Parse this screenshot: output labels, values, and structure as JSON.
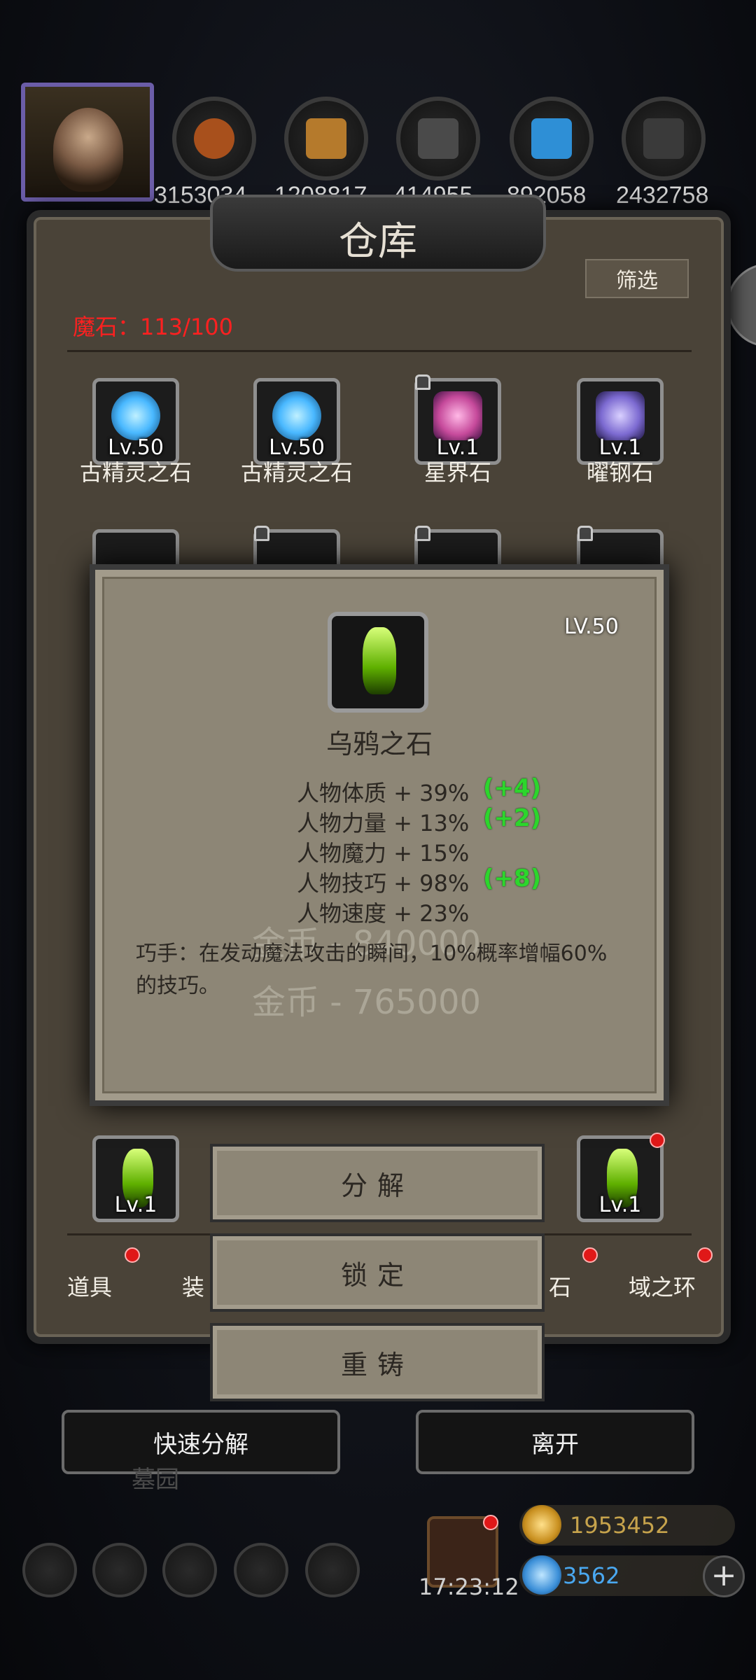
{
  "resources": [
    {
      "icon": "sausage-icon",
      "value": "3153034",
      "color": "#a8501c"
    },
    {
      "icon": "wood-plank-icon",
      "value": "1208817",
      "color": "#b57a2c"
    },
    {
      "icon": "iron-bar-icon",
      "value": "414955",
      "color": "#4a4a4a"
    },
    {
      "icon": "blue-crystal-icon",
      "value": "892058",
      "color": "#2e8fd6"
    },
    {
      "icon": "steel-bar-icon",
      "value": "2432758",
      "color": "#3a3a3a"
    }
  ],
  "panel": {
    "title": "仓库",
    "filter_label": "筛选",
    "magic_stone_counter": "魔石：113/100"
  },
  "top_items": [
    {
      "name": "古精灵之石",
      "level": "Lv.50",
      "gem": "blue-gem-icon",
      "locked": false,
      "color": "#49b8ff"
    },
    {
      "name": "古精灵之石",
      "level": "Lv.50",
      "gem": "blue-gem-icon",
      "locked": false,
      "color": "#49b8ff"
    },
    {
      "name": "星界石",
      "level": "Lv.1",
      "gem": "pink-crystal-icon",
      "locked": true,
      "color": "#c64a9b"
    },
    {
      "name": "曜钢石",
      "level": "Lv.1",
      "gem": "purple-crystal-icon",
      "locked": false,
      "color": "#7c6ad1"
    }
  ],
  "bottom_items": [
    {
      "level": "Lv.1",
      "gem": "green-crystal-icon",
      "color": "#7fd000"
    },
    {
      "level": "Lv.1",
      "gem": "green-crystal-icon",
      "color": "#7fd000"
    }
  ],
  "popup": {
    "level": "LV.50",
    "name": "乌鸦之石",
    "stats": [
      {
        "label": "人物体质 + 39%",
        "bonus": "(+4)"
      },
      {
        "label": "人物力量 + 13%",
        "bonus": "(+2)"
      },
      {
        "label": "人物魔力 + 15%",
        "bonus": ""
      },
      {
        "label": "人物技巧 + 98%",
        "bonus": "(+8)"
      },
      {
        "label": "人物速度 + 23%",
        "bonus": ""
      }
    ],
    "description": "巧手：在发动魔法攻击的瞬间，10%概率增幅60%的技巧。",
    "ghost_prices": [
      "金币 - 840000",
      "金币 - 765000"
    ]
  },
  "actions": {
    "decompose": "分解",
    "lock": "锁定",
    "reforge": "重铸"
  },
  "tabs": {
    "items": "道具",
    "equip": "装",
    "stone": "石",
    "ring": "域之环"
  },
  "bottom_buttons": {
    "quick_decompose": "快速分解",
    "leave": "离开"
  },
  "hud": {
    "time": "17:23:12",
    "gold": "1953452",
    "gems": "3562",
    "behind_text": "墓园"
  }
}
